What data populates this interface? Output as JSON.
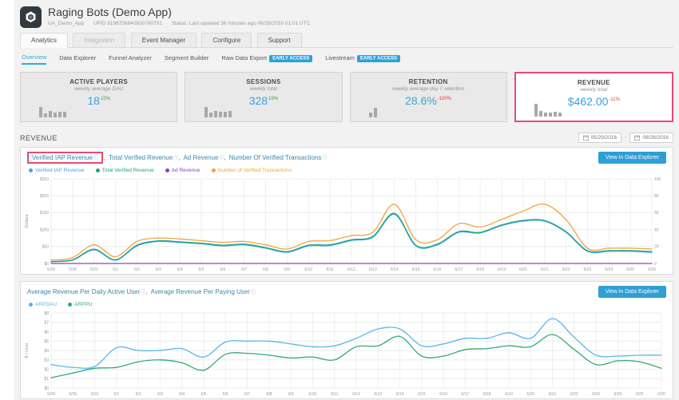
{
  "icons": {
    "info": "ⓘ"
  },
  "app": {
    "title": "Raging Bots (Demo App)",
    "app_key": "UA_Demo_App",
    "upid": "UPID 8198756840830780791",
    "status": "Status: Last updated 36 minutes ago 06/28/2016 01:01 UTC"
  },
  "tabs": [
    {
      "label": "Analytics"
    },
    {
      "label": "Integration"
    },
    {
      "label": "Event Manager"
    },
    {
      "label": "Configure"
    },
    {
      "label": "Support"
    }
  ],
  "subnav": {
    "items": [
      {
        "label": "Overview"
      },
      {
        "label": "Data Explorer"
      },
      {
        "label": "Funnel Analyzer"
      },
      {
        "label": "Segment Builder"
      },
      {
        "label": "Raw Data Export",
        "badge": "EARLY ACCESS"
      },
      {
        "label": "Livestream",
        "badge": "EARLY ACCESS"
      }
    ]
  },
  "cards": [
    {
      "title": "ACTIVE PLAYERS",
      "subtitle": "weekly average DAU",
      "value": "18",
      "delta": "15%",
      "delta_color": "#43a047",
      "bars": [
        13,
        5,
        8,
        6,
        7,
        7
      ]
    },
    {
      "title": "SESSIONS",
      "subtitle": "weekly total",
      "value": "328",
      "delta": "19%",
      "delta_color": "#43a047",
      "bars": [
        13,
        6,
        8,
        7,
        7,
        8
      ]
    },
    {
      "title": "RETENTION",
      "subtitle": "weekly average day 7 retention",
      "value": "28.6%",
      "delta": "-100%",
      "delta_color": "#e53935",
      "bars": [
        6,
        12
      ]
    },
    {
      "title": "REVENUE",
      "subtitle": "weekly total",
      "value": "$462.00",
      "delta": "-11%",
      "delta_color": "#e53935",
      "highlighted": true,
      "bars": [
        16,
        7,
        5,
        5,
        6,
        5
      ]
    }
  ],
  "revenue_section": {
    "title": "REVENUE",
    "date_from": "05/29/2016",
    "date_to": "06/28/2016",
    "date_separator": "-"
  },
  "panels": [
    {
      "title_parts": [
        "Verified IAP Revenue",
        "Total Verified Revenue",
        "Ad Revenue",
        "Number Of Verified Transactions"
      ],
      "separator": ",",
      "button": "View in Data Explorer",
      "legend": [
        {
          "label": "Verified IAP Revenue",
          "color": "#4aa3df"
        },
        {
          "label": "Total Verified Revenue",
          "color": "#18a689"
        },
        {
          "label": "Ad Revenue",
          "color": "#8e44ad"
        },
        {
          "label": "Number of Verified Transactions",
          "color": "#f2a33c"
        }
      ]
    },
    {
      "title_parts": [
        "Average Revenue Per Daily Active User",
        "Average Revenue Per Paying User"
      ],
      "separator": ",",
      "button": "View in Data Explorer",
      "legend": [
        {
          "label": "ARPDAU",
          "color": "#54b8e8"
        },
        {
          "label": "ARPPU",
          "color": "#33a879"
        }
      ]
    }
  ],
  "chart_data": [
    {
      "type": "line",
      "title": "Verified IAP Revenue, Total Verified Revenue, Ad Revenue, Number Of Verified Transactions",
      "xlabel": "",
      "ylabel": "Dollars",
      "ylim": [
        0,
        250
      ],
      "yticks": [
        "$0",
        "$50",
        "$100",
        "$150",
        "$200",
        "$250"
      ],
      "ylim_right": [
        0,
        100
      ],
      "yticks_right": [
        "0",
        "20",
        "40",
        "60",
        "80",
        "100"
      ],
      "grid": true,
      "legend_position": "top-left",
      "categories": [
        "5/29",
        "5/30",
        "5/31",
        "6/1",
        "6/2",
        "6/3",
        "6/4",
        "6/5",
        "6/6",
        "6/7",
        "6/8",
        "6/9",
        "6/10",
        "6/11",
        "6/12",
        "6/13",
        "6/14",
        "6/15",
        "6/16",
        "6/17",
        "6/18",
        "6/19",
        "6/20",
        "6/21",
        "6/22",
        "6/23",
        "6/24",
        "6/25",
        "6/26"
      ],
      "series": [
        {
          "name": "Verified IAP Revenue",
          "color": "#4aa3df",
          "axis": "left",
          "values": [
            5,
            10,
            40,
            10,
            52,
            65,
            62,
            58,
            52,
            55,
            45,
            33,
            52,
            53,
            68,
            78,
            145,
            52,
            55,
            92,
            90,
            112,
            125,
            125,
            92,
            36,
            36,
            36,
            33
          ]
        },
        {
          "name": "Total Verified Revenue",
          "color": "#18a689",
          "axis": "left",
          "values": [
            6,
            11,
            42,
            11,
            54,
            67,
            64,
            60,
            54,
            57,
            47,
            35,
            54,
            55,
            70,
            80,
            148,
            54,
            57,
            94,
            92,
            114,
            127,
            127,
            94,
            38,
            38,
            38,
            35
          ]
        },
        {
          "name": "Ad Revenue",
          "color": "#8e44ad",
          "axis": "left",
          "values": [
            0,
            0,
            0,
            0,
            0,
            0,
            0,
            0,
            0,
            0,
            0,
            0,
            0,
            0,
            0,
            0,
            0,
            0,
            0,
            0,
            0,
            0,
            0,
            0,
            0,
            0,
            0,
            0,
            0
          ]
        },
        {
          "name": "Number of Verified Transactions",
          "color": "#f2a33c",
          "axis": "right",
          "values": [
            4,
            7,
            22,
            8,
            26,
            30,
            29,
            27,
            25,
            26,
            22,
            17,
            26,
            27,
            33,
            37,
            70,
            28,
            28,
            47,
            43,
            52,
            62,
            70,
            52,
            18,
            18,
            18,
            17
          ]
        }
      ]
    },
    {
      "type": "line",
      "title": "Average Revenue Per Daily Active User, Average Revenue Per Paying User",
      "xlabel": "",
      "ylabel": "$ / User",
      "ylim": [
        0,
        8
      ],
      "yticks": [
        "$0",
        "$1",
        "$2",
        "$3",
        "$4",
        "$5",
        "$6",
        "$7",
        "$8"
      ],
      "grid": true,
      "legend_position": "top-left",
      "categories": [
        "5/29",
        "5/30",
        "5/31",
        "6/1",
        "6/2",
        "6/3",
        "6/4",
        "6/5",
        "6/6",
        "6/7",
        "6/8",
        "6/9",
        "6/10",
        "6/11",
        "6/12",
        "6/13",
        "6/14",
        "6/15",
        "6/16",
        "6/17",
        "6/18",
        "6/19",
        "6/20",
        "6/21",
        "6/22",
        "6/23",
        "6/24",
        "6/25",
        "6/26"
      ],
      "series": [
        {
          "name": "ARPDAU",
          "color": "#54b8e8",
          "axis": "left",
          "values": [
            2.5,
            2.2,
            2.3,
            4.3,
            4.0,
            4.0,
            4.2,
            3.3,
            4.9,
            5.0,
            5.0,
            4.7,
            4.4,
            4.5,
            5.3,
            6.3,
            6.3,
            4.5,
            4.7,
            5.3,
            5.3,
            5.9,
            5.3,
            7.4,
            5.4,
            3.5,
            3.4,
            3.5,
            3.5
          ]
        },
        {
          "name": "ARPPU",
          "color": "#33a879",
          "axis": "left",
          "values": [
            1.1,
            1.6,
            2.1,
            2.2,
            2.8,
            3.0,
            2.7,
            1.9,
            3.6,
            3.7,
            3.5,
            3.2,
            3.3,
            3.0,
            4.4,
            4.5,
            5.5,
            3.4,
            3.4,
            4.1,
            4.2,
            4.5,
            4.4,
            5.7,
            4.1,
            2.5,
            2.9,
            2.8,
            2.1
          ]
        }
      ]
    }
  ]
}
